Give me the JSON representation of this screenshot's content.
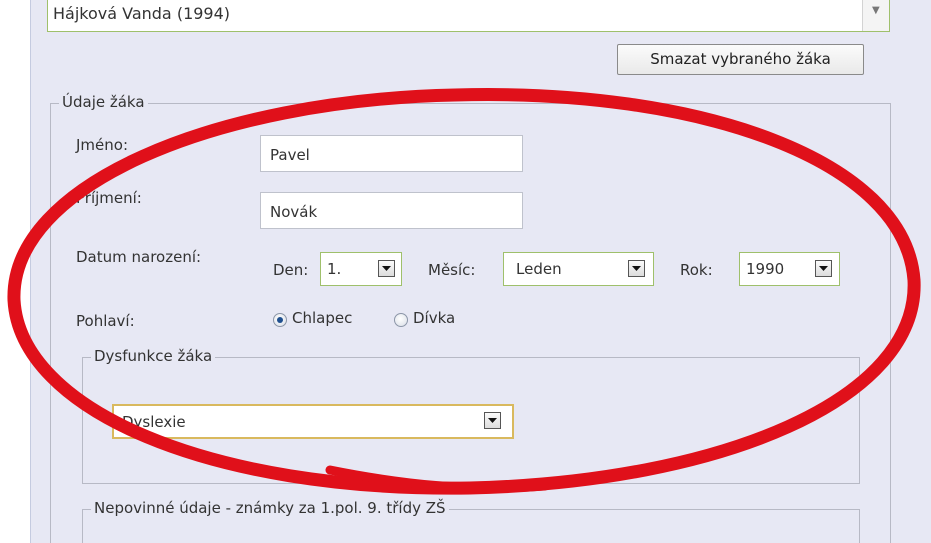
{
  "student_select": {
    "value": "Hájková Vanda (1994)"
  },
  "delete_button": {
    "label": "Smazat vybraného žáka"
  },
  "student_details": {
    "legend": "Údaje žáka",
    "first_name": {
      "label": "Jméno:",
      "value": "Pavel"
    },
    "last_name": {
      "label": "Příjmení:",
      "value": "Novák"
    },
    "birth_date": {
      "label": "Datum narození:",
      "day": {
        "label": "Den:",
        "value": "1."
      },
      "month": {
        "label": "Měsíc:",
        "value": "Leden"
      },
      "year": {
        "label": "Rok:",
        "value": "1990"
      }
    },
    "gender": {
      "label": "Pohlaví:",
      "options": [
        {
          "label": "Chlapec",
          "checked": true
        },
        {
          "label": "Dívka",
          "checked": false
        }
      ]
    }
  },
  "dysfunction": {
    "legend": "Dysfunkce žáka",
    "value": "Dyslexie"
  },
  "optional": {
    "legend": "Nepovinné údaje - známky za 1.pol. 9. třídy ZŠ"
  },
  "colors": {
    "panel_bg": "#e7e8f4",
    "highlight_ellipse": "#e0101a",
    "combo_border": "#9fc06b",
    "focused_combo_border": "#d9b95e"
  },
  "icons": {
    "dropdown_arrow": "chevron-down-icon",
    "radio_checked": "radio-checked-icon",
    "radio_unchecked": "radio-unchecked-icon"
  }
}
